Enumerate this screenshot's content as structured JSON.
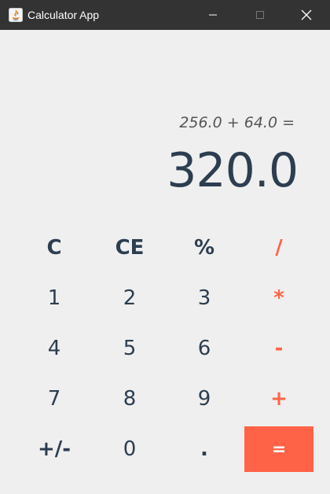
{
  "window": {
    "title": "Calculator App"
  },
  "display": {
    "expression": "256.0 + 64.0 =",
    "result": "320.0"
  },
  "keys": {
    "clear": "C",
    "clear_entry": "CE",
    "percent": "%",
    "divide": "/",
    "one": "1",
    "two": "2",
    "three": "3",
    "multiply": "*",
    "four": "4",
    "five": "5",
    "six": "6",
    "subtract": "-",
    "seven": "7",
    "eight": "8",
    "nine": "9",
    "add": "+",
    "negate": "+/-",
    "zero": "0",
    "decimal": ".",
    "equals": "="
  },
  "colors": {
    "operator": "#ff6347",
    "digit": "#2c3e50",
    "background": "#efefef",
    "titlebar": "#333333"
  }
}
